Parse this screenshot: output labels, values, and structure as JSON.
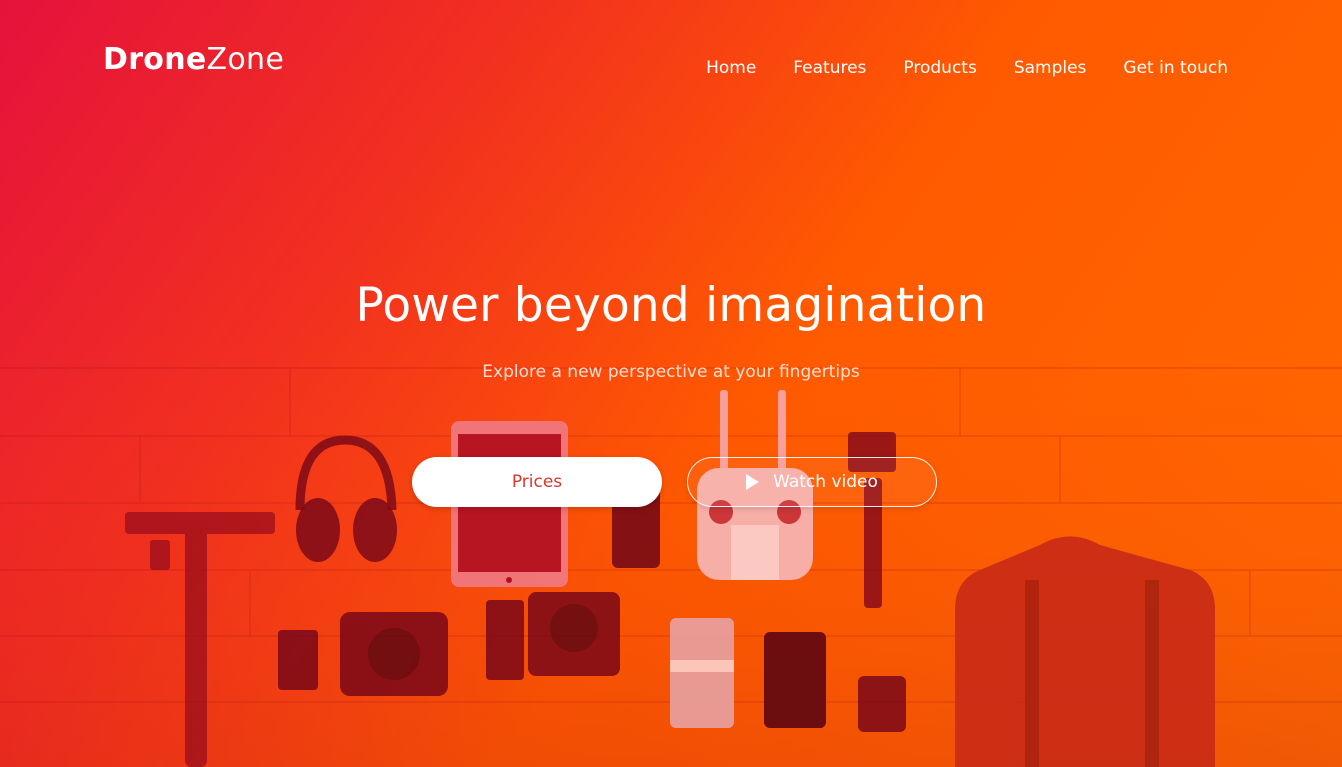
{
  "brand": {
    "name_bold": "Drone",
    "name_light": "Zone"
  },
  "nav": {
    "items": [
      {
        "label": "Home"
      },
      {
        "label": "Features"
      },
      {
        "label": "Products"
      },
      {
        "label": "Samples"
      },
      {
        "label": "Get in touch"
      }
    ]
  },
  "hero": {
    "title": "Power beyond imagination",
    "subtitle": "Explore a new perspective at your fingertips",
    "primary_button": "Prices",
    "secondary_button": "Watch video"
  },
  "colors": {
    "gradient_start": "#e5123c",
    "gradient_end": "#ff6a00",
    "button_text": "#d6382a",
    "text": "#ffffff"
  },
  "icons": {
    "play": "play-icon"
  }
}
